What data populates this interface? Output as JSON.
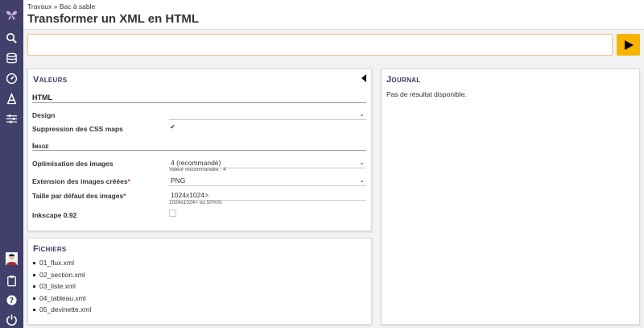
{
  "breadcrumb": "Travaux » Bac à sable",
  "page_title": "Transformer un XML en HTML",
  "command": {
    "value": ""
  },
  "valeurs": {
    "title": "Valeurs",
    "html_section": "HTML",
    "design_label": "Design",
    "design_value": "",
    "css_maps_label": "Suppression des CSS maps",
    "css_maps_checked": true,
    "image_section": "Image",
    "optim_label": "Optimisation des images",
    "optim_value": "4 (recommandé)",
    "optim_hint": "Valeur recommandée : 4",
    "ext_label": "Extension des images créées",
    "ext_value": "PNG",
    "size_label": "Taille par défaut des images",
    "size_value": "1024x1024>",
    "size_hint": "1024x1024> ou 50%%",
    "inkscape_label": "Inkscape 0.92",
    "inkscape_checked": false,
    "required_mark": "*"
  },
  "fichiers": {
    "title": "Fichiers",
    "items": [
      "01_flux.xml",
      "02_section.xml",
      "03_liste.xml",
      "04_tableau.xml",
      "05_devinette.xml"
    ]
  },
  "journal": {
    "title": "Journal",
    "message": "Pas de résultat disponible."
  },
  "colors": {
    "sidebar": "#41406b",
    "accent": "#f5b400",
    "title": "#3a3a5e"
  }
}
